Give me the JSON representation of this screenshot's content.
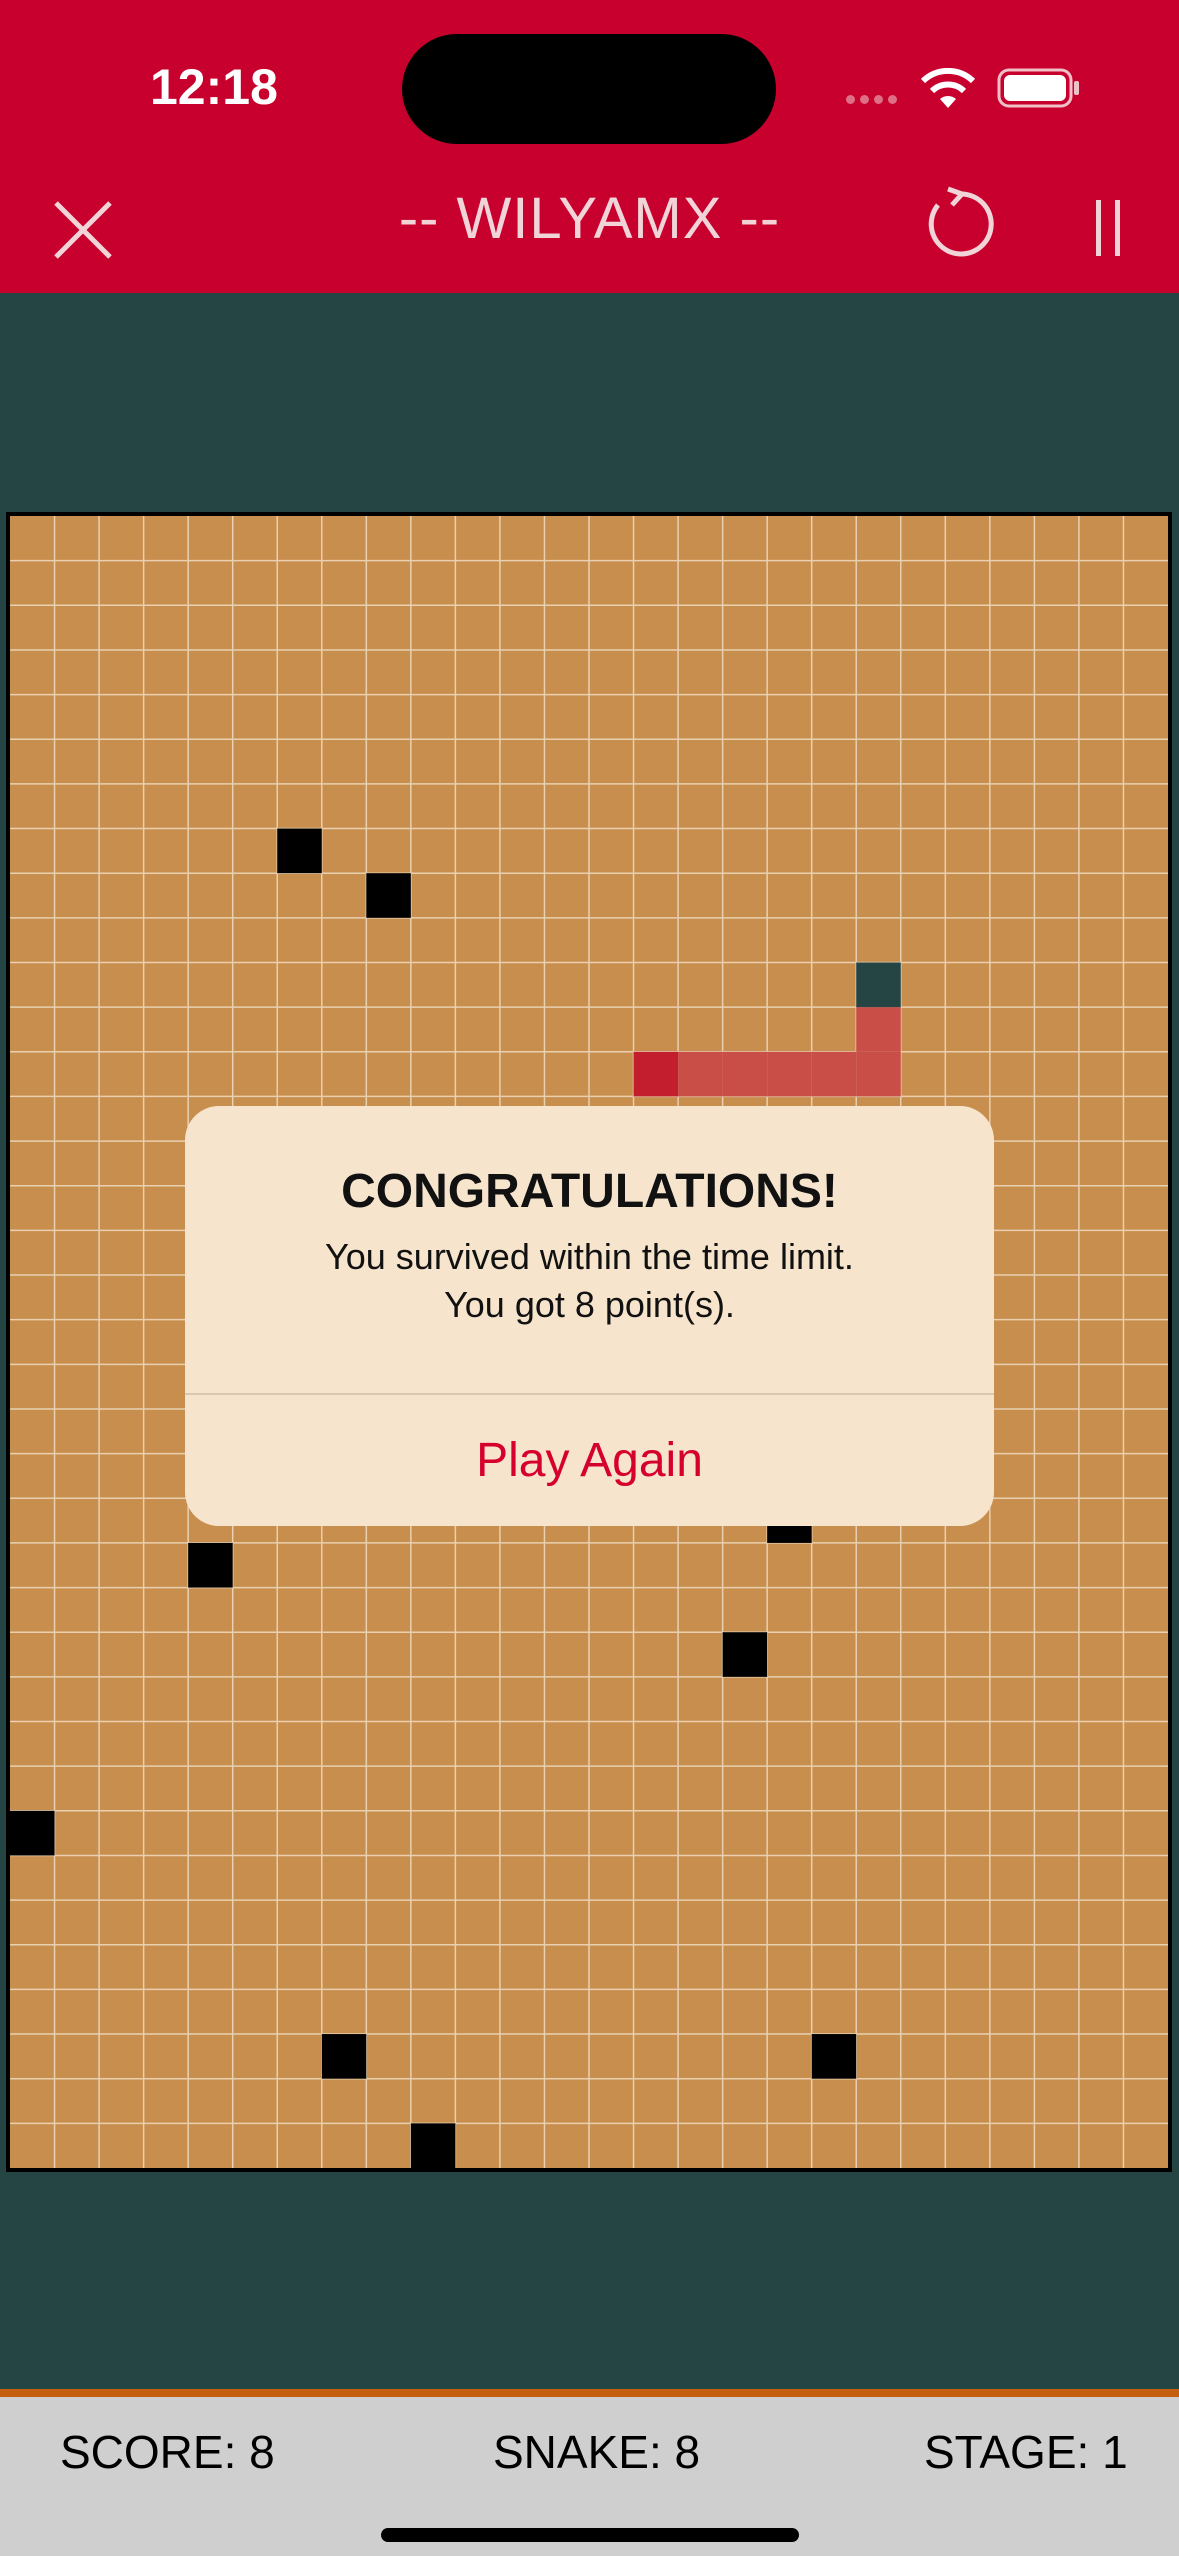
{
  "status_bar": {
    "time": "12:18"
  },
  "header": {
    "title": "-- WILYAMX --",
    "close_icon": "close-icon",
    "restart_icon": "restart-icon",
    "pause_icon": "pause-icon"
  },
  "board": {
    "grid": {
      "cols": 26,
      "rows": 37
    },
    "colors": {
      "background": "#c88e4e",
      "gridline": "#e8d0b0",
      "obstacle": "#000000",
      "snake_head": "#c21e2e",
      "snake_body": "#c94e47",
      "food": "#254545"
    },
    "obstacles": [
      [
        6,
        7
      ],
      [
        8,
        8
      ],
      [
        4,
        23
      ],
      [
        17,
        22
      ],
      [
        16,
        25
      ],
      [
        0,
        29
      ],
      [
        7,
        34
      ],
      [
        18,
        34
      ],
      [
        9,
        36
      ]
    ],
    "snake": [
      [
        14,
        12
      ],
      [
        15,
        12
      ],
      [
        16,
        12
      ],
      [
        17,
        12
      ],
      [
        18,
        12
      ],
      [
        19,
        12
      ],
      [
        19,
        11
      ]
    ],
    "food": [
      19,
      10
    ]
  },
  "dialog": {
    "title": "CONGRATULATIONS!",
    "message_line1": "You survived within the time limit.",
    "message_line2": "You got 8 point(s).",
    "button": "Play Again"
  },
  "footer": {
    "score": "SCORE: 8",
    "snake": "SNAKE: 8",
    "stage": "STAGE: 1"
  }
}
